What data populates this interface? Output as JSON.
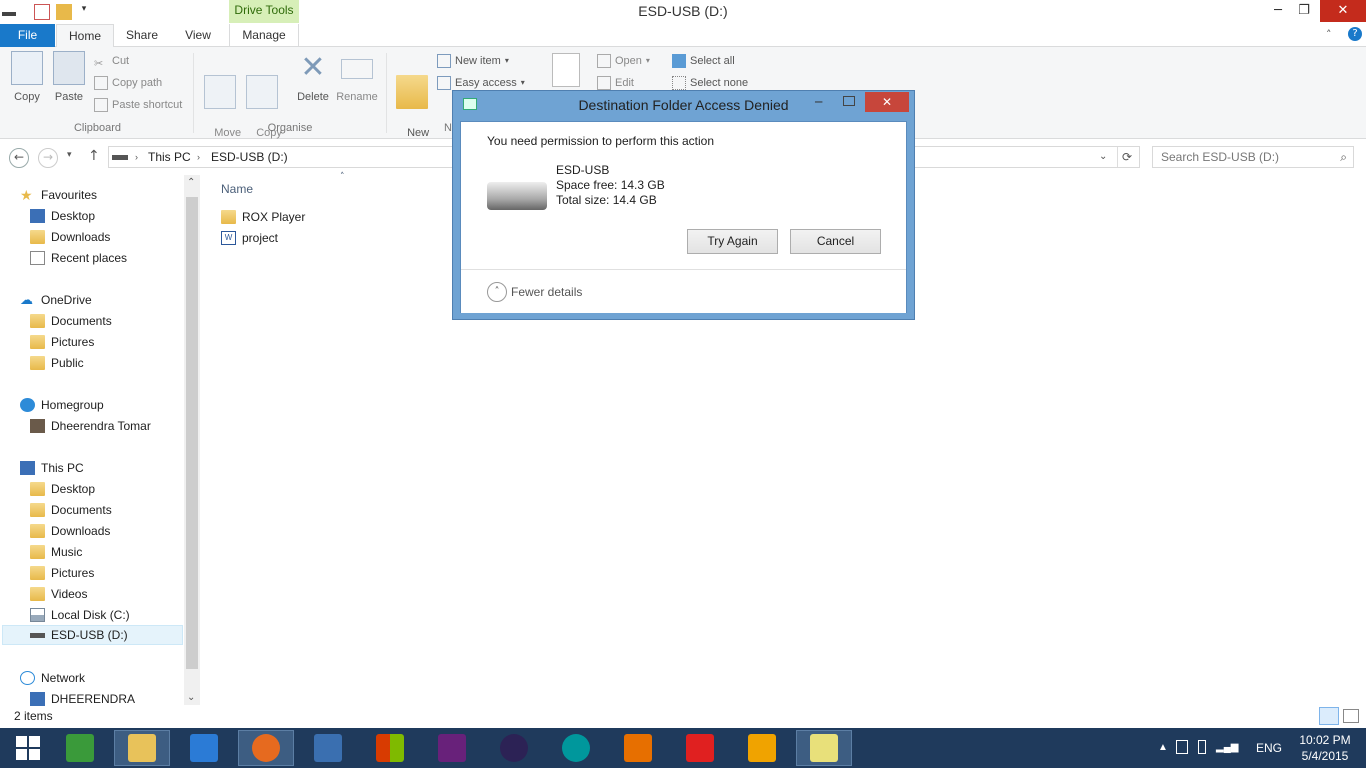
{
  "window": {
    "title": "ESD-USB (D:)",
    "context_tab": "Drive Tools",
    "minimize": "─",
    "maximize": "❐",
    "close": "✕"
  },
  "tabs": [
    "File",
    "Home",
    "Share",
    "View",
    "Manage"
  ],
  "ribbon": {
    "copy": "Copy",
    "paste": "Paste",
    "cut": "Cut",
    "copy_path": "Copy path",
    "paste_shortcut": "Paste shortcut",
    "move_to": "Move\nto",
    "copy_to": "Copy\nto",
    "delete": "Delete",
    "rename": "Rename",
    "new_folder": "New\nfolder",
    "new_item": "New item",
    "easy_access": "Easy access",
    "open": "Open",
    "edit": "Edit",
    "select_all": "Select all",
    "select_none": "Select none",
    "group_clipboard": "Clipboard",
    "group_organise": "Organise",
    "group_new_partial": "N"
  },
  "address": {
    "path": [
      "This PC",
      "ESD-USB (D:)"
    ],
    "search_placeholder": "Search ESD-USB (D:)"
  },
  "nav": {
    "favourites": "Favourites",
    "fav_items": [
      "Desktop",
      "Downloads",
      "Recent places"
    ],
    "onedrive": "OneDrive",
    "onedrive_items": [
      "Documents",
      "Pictures",
      "Public"
    ],
    "homegroup": "Homegroup",
    "homegroup_items": [
      "Dheerendra Tomar"
    ],
    "thispc": "This PC",
    "thispc_items": [
      "Desktop",
      "Documents",
      "Downloads",
      "Music",
      "Pictures",
      "Videos",
      "Local Disk (C:)",
      "ESD-USB (D:)"
    ],
    "network": "Network",
    "network_items": [
      "DHEERENDRA"
    ]
  },
  "content": {
    "column_name": "Name",
    "files": [
      "ROX Player",
      "project"
    ]
  },
  "status": {
    "items": "2 items"
  },
  "dialog": {
    "title": "Destination Folder Access Denied",
    "message": "You need permission to perform this action",
    "drive_name": "ESD-USB",
    "space_free": "Space free: 14.3 GB",
    "total_size": "Total size: 14.4 GB",
    "try_again": "Try Again",
    "cancel": "Cancel",
    "fewer_details": "Fewer details"
  },
  "taskbar": {
    "time": "10:02 PM",
    "date": "5/4/2015",
    "language": "ENG"
  },
  "colors": {
    "file_tab": "#1979ca",
    "context_tab": "#d7efb8",
    "taskbar": "#1f3a5c",
    "dialog_frame": "#6fa3d3"
  }
}
